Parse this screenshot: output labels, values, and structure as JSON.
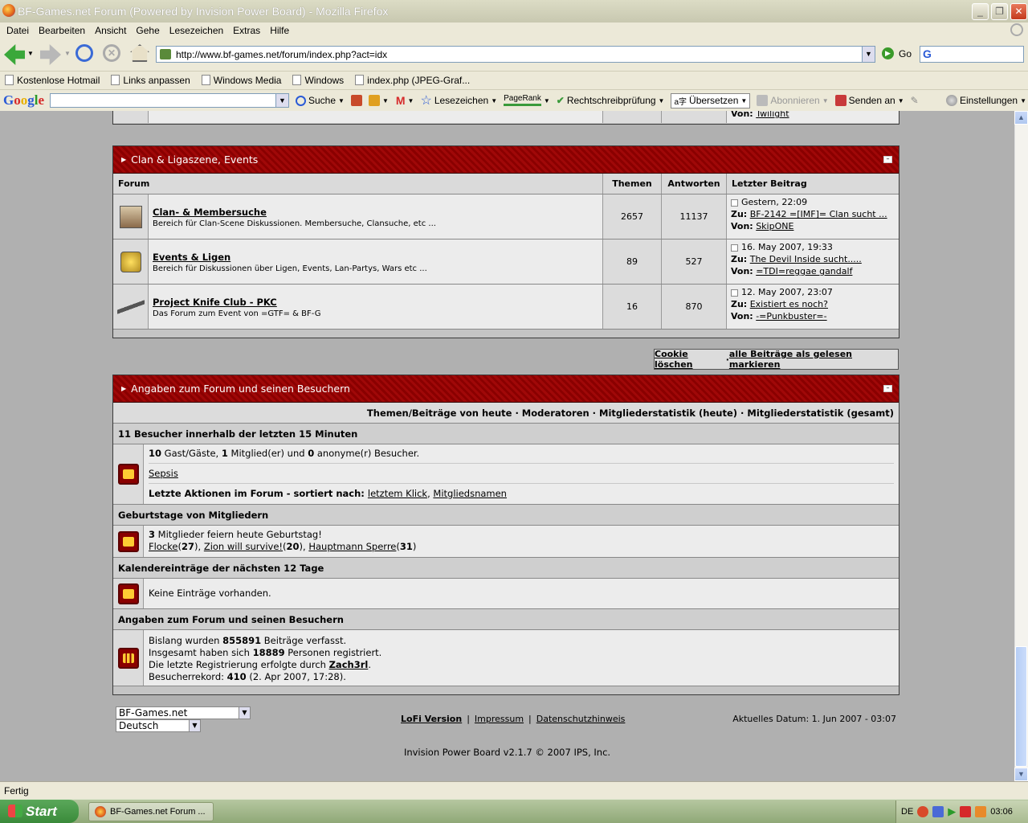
{
  "window": {
    "title": "BF-Games.net Forum (Powered by Invision Power Board) - Mozilla Firefox"
  },
  "menu": [
    "Datei",
    "Bearbeiten",
    "Ansicht",
    "Gehe",
    "Lesezeichen",
    "Extras",
    "Hilfe"
  ],
  "nav": {
    "url": "http://www.bf-games.net/forum/index.php?act=idx",
    "go_label": "Go"
  },
  "bookmarks": [
    "Kostenlose Hotmail",
    "Links anpassen",
    "Windows Media",
    "Windows",
    "index.php (JPEG-Graf..."
  ],
  "google_bar": {
    "search_label": "Suche",
    "bookmarks_label": "Lesezeichen",
    "pagerank_label": "PageRank",
    "spell_label": "Rechtschreibprüfung",
    "translate_label": "Übersetzen",
    "subscribe_label": "Abonnieren",
    "send_label": "Senden an",
    "settings_label": "Einstellungen"
  },
  "partial_row": {
    "von_label": "Von:",
    "user": "Twilight"
  },
  "clan_section": {
    "title": "Clan & Ligaszene, Events",
    "headers": {
      "forum": "Forum",
      "themen": "Themen",
      "antworten": "Antworten",
      "letzter": "Letzter Beitrag"
    },
    "rows": [
      {
        "icon": "wanted-icon",
        "name": "Clan- & Membersuche",
        "desc": "Bereich für Clan-Scene Diskussionen. Membersuche, Clansuche, etc ...",
        "themen": "2657",
        "antworten": "11137",
        "date": "Gestern, 22:09",
        "zu_label": "Zu:",
        "topic": "BF-2142 =[IMF]= Clan sucht ...",
        "von_label": "Von:",
        "user": "SkipONE"
      },
      {
        "icon": "calendar-trophy-icon",
        "name": "Events & Ligen",
        "desc": "Bereich für Diskussionen über Ligen, Events, Lan-Partys, Wars etc ...",
        "themen": "89",
        "antworten": "527",
        "date": "16. May 2007, 19:33",
        "zu_label": "Zu:",
        "topic": "The Devil Inside sucht.....",
        "von_label": "Von:",
        "user": "=TDI=reggae gandalf"
      },
      {
        "icon": "knife-icon",
        "name": "Project Knife Club - PKC",
        "desc": "Das Forum zum Event von =GTF= & BF-G",
        "themen": "16",
        "antworten": "870",
        "date": "12. May 2007, 23:07",
        "zu_label": "Zu:",
        "topic": "Existiert es noch?",
        "von_label": "Von:",
        "user": "-=Punkbuster=-"
      }
    ]
  },
  "actions": {
    "cookie": "Cookie löschen",
    "separator": " · ",
    "mark_read": "alle Beiträge als gelesen markieren"
  },
  "stats": {
    "title": "Angaben zum Forum und seinen Besuchern",
    "links": "Themen/Beiträge von heute · Moderatoren · Mitgliederstatistik (heute) · Mitgliederstatistik (gesamt)",
    "online": {
      "heading": "11 Besucher innerhalb der letzten 15 Minuten",
      "guests": "10",
      "guests_label": " Gast/Gäste, ",
      "members": "1",
      "members_label": " Mitglied(er) und ",
      "anon": "0",
      "anon_label": " anonyme(r) Besucher.",
      "user": "Sepsis",
      "sort_label": "Letzte Aktionen im Forum - sortiert nach: ",
      "sort_click": "letztem Klick",
      "sort_sep": ", ",
      "sort_name": "Mitgliedsnamen"
    },
    "birthdays": {
      "heading": "Geburtstage von Mitgliedern",
      "count": "3",
      "count_label": " Mitglieder feiern heute Geburtstag!",
      "people": [
        {
          "name": "Flocke",
          "age": "27"
        },
        {
          "name": "Zion will survive!",
          "age": "20"
        },
        {
          "name": "Hauptmann Sperre",
          "age": "31"
        }
      ]
    },
    "calendar": {
      "heading": "Kalendereinträge der nächsten 12 Tage",
      "text": "Keine Einträge vorhanden."
    },
    "board": {
      "heading": "Angaben zum Forum und seinen Besuchern",
      "line1_a": "Bislang wurden ",
      "posts": "855891",
      "line1_b": " Beiträge verfasst.",
      "line2_a": "Insgesamt haben sich ",
      "registered": "18889",
      "line2_b": " Personen registriert.",
      "line3_a": "Die letzte Registrierung erfolgte durch ",
      "last_user": "Zach3rl",
      "line3_b": ".",
      "line4_a": "Besucherrekord: ",
      "record": "410",
      "line4_b": " (2. Apr 2007, 17:28)."
    }
  },
  "footer": {
    "skin_select": "BF-Games.net",
    "lang_select": "Deutsch",
    "lofi": "LoFi Version",
    "impressum": "Impressum",
    "datenschutz": "Datenschutzhinweis",
    "date": "Aktuelles Datum: 1. Jun 2007 - 03:07",
    "powered": "Invision Power Board v2.1.7 © 2007  IPS, Inc."
  },
  "status": "Fertig",
  "taskbar": {
    "start": "Start",
    "item": "BF-Games.net Forum ...",
    "lang": "DE",
    "time": "03:06"
  }
}
